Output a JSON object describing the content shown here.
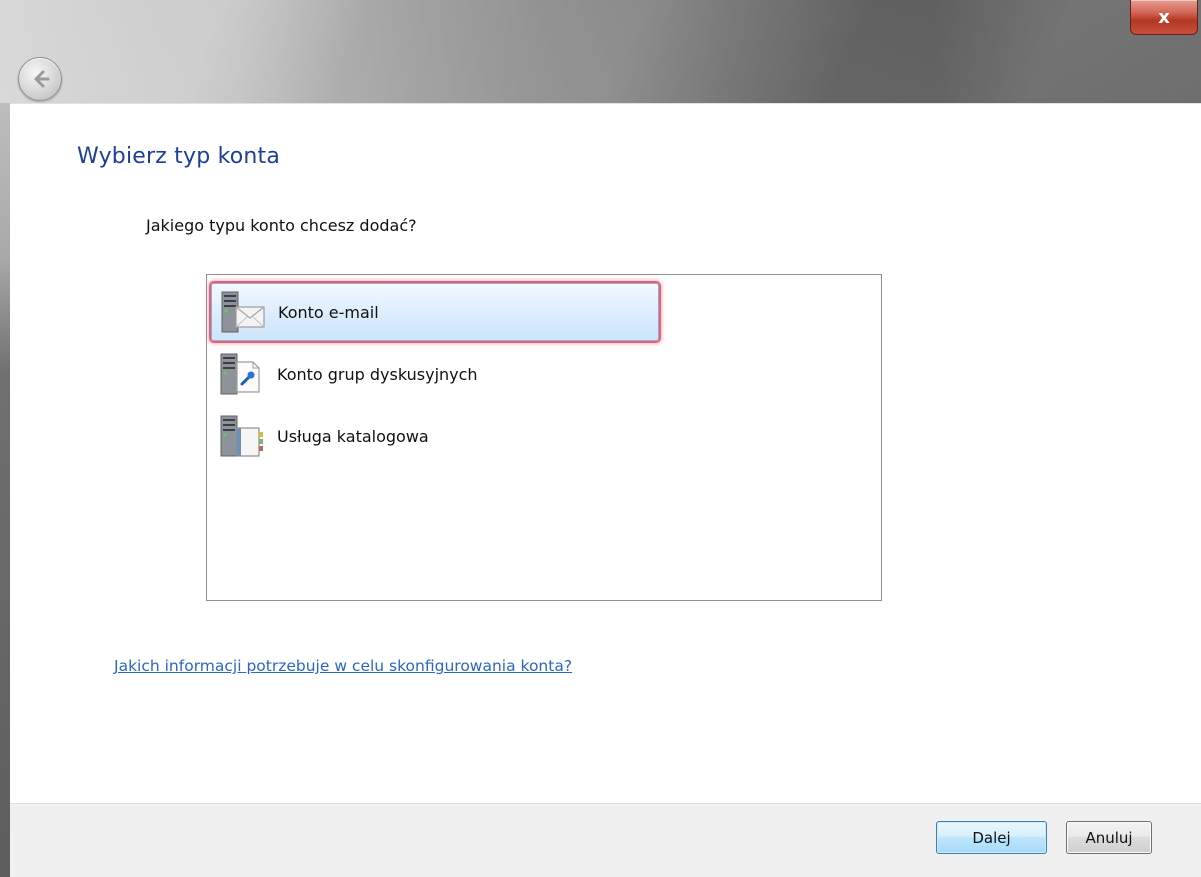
{
  "window": {
    "close_label": "x"
  },
  "header": {
    "back_icon": "back-arrow-icon"
  },
  "main": {
    "title": "Wybierz typ konta",
    "question": "Jakiego typu konto chcesz dodać?",
    "account_types": [
      {
        "label": "Konto e-mail",
        "icon": "email-server-icon",
        "selected": true
      },
      {
        "label": "Konto grup dyskusyjnych",
        "icon": "newsgroup-server-icon",
        "selected": false
      },
      {
        "label": "Usługa katalogowa",
        "icon": "directory-server-icon",
        "selected": false
      }
    ],
    "help_link": "Jakich informacji potrzebuje w celu skonfigurowania konta?"
  },
  "footer": {
    "next_label": "Dalej",
    "cancel_label": "Anuluj"
  },
  "colors": {
    "title": "#1e3e9a",
    "link": "#2b66c8",
    "selection_highlight": "#ee5f6e",
    "close_button": "#b23723"
  }
}
